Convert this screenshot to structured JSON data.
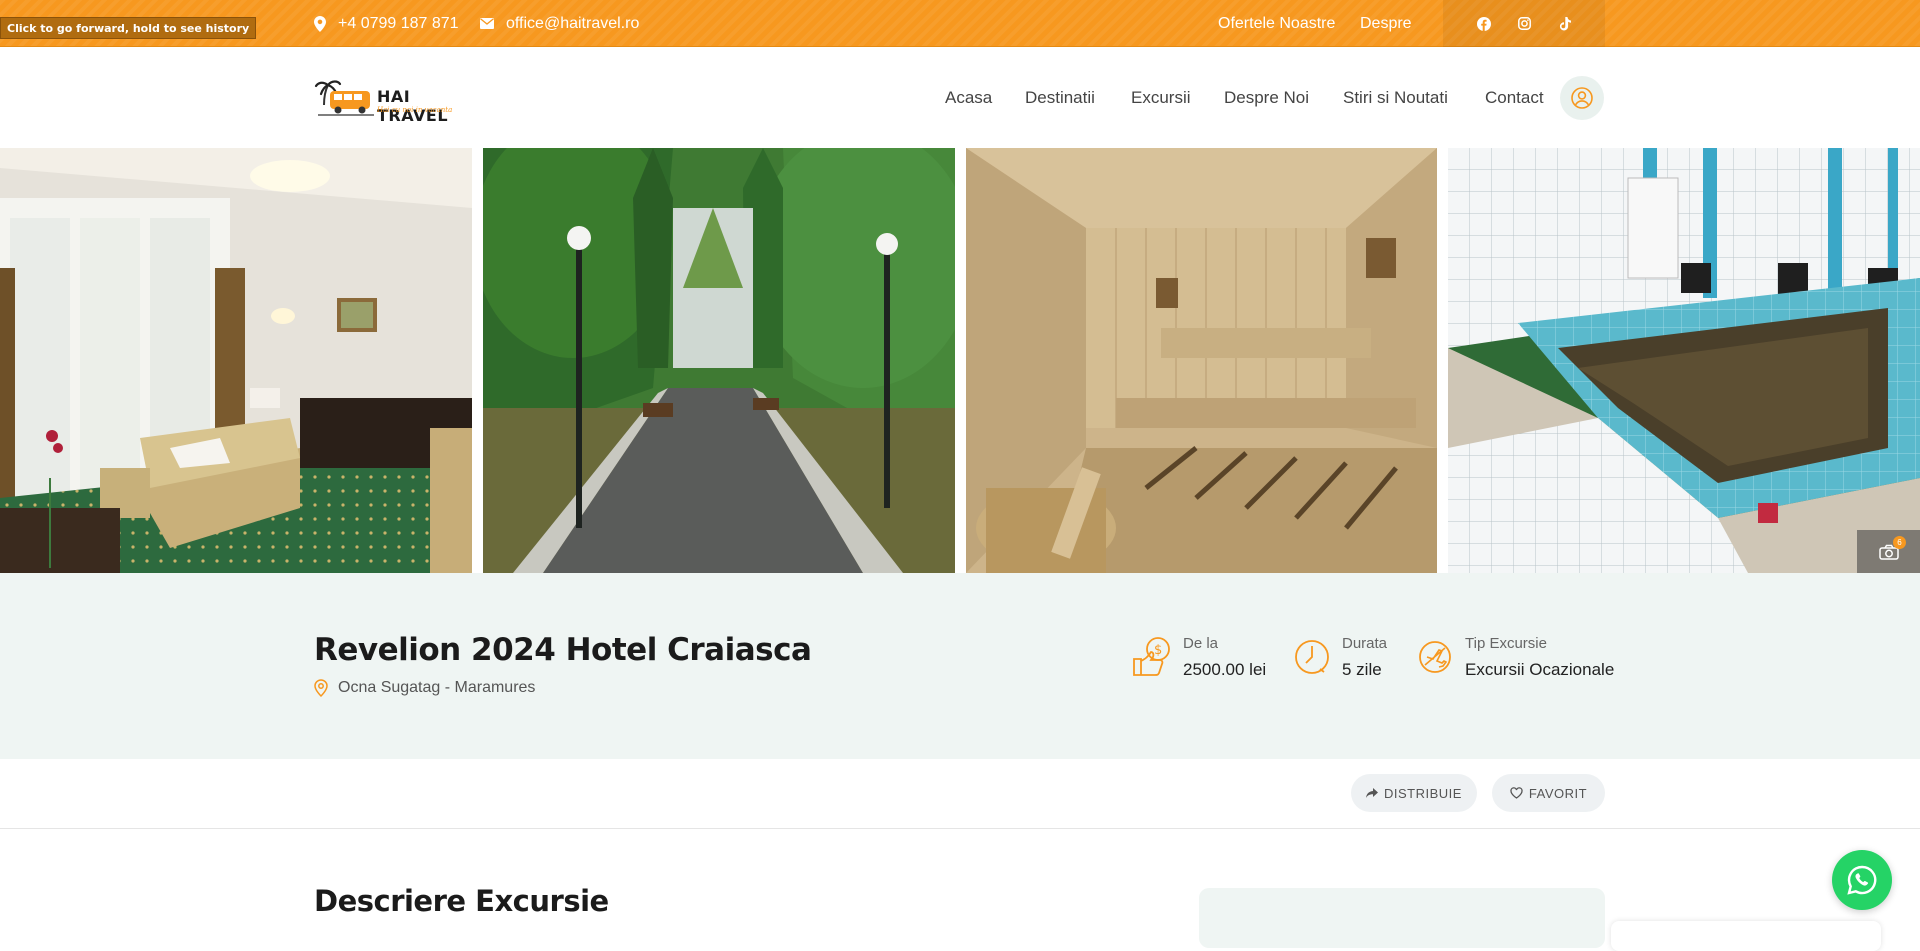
{
  "browser": {
    "back_tooltip": "Click to go forward, hold to see history"
  },
  "topbar": {
    "phone": "+4 0799 187 871",
    "email": "office@haitravel.ro",
    "links": [
      "Ofertele Noastre",
      "Despre"
    ],
    "social": [
      "facebook-icon",
      "instagram-icon",
      "tiktok-icon"
    ],
    "color": "#f7981f"
  },
  "header": {
    "logo_text": "HAI TRAVEL",
    "logo_tagline": "Hai cu noi in vacanta",
    "nav": [
      "Acasa",
      "Destinatii",
      "Excursii",
      "Despre Noi",
      "Stiri si Noutati",
      "Contact"
    ],
    "account_icon": "user-circle-icon"
  },
  "gallery": {
    "photos": [
      "hotel-room-photo",
      "park-alley-photo",
      "sauna-photo",
      "indoor-pool-photo"
    ],
    "count": "6"
  },
  "tour": {
    "title": "Revelion 2024 Hotel Craiasca",
    "location": "Ocna Sugatag - Maramures",
    "price_label": "De la",
    "price_value": "2500.00 lei",
    "duration_label": "Durata",
    "duration_value": "5 zile",
    "type_label": "Tip Excursie",
    "type_value": "Excursii Ocazionale"
  },
  "actions": {
    "share": "DISTRIBUIE",
    "favorite": "FAVORIT"
  },
  "description": {
    "title": "Descriere Excursie"
  },
  "colors": {
    "accent": "#f7981f",
    "band": "#eff5f3",
    "whatsapp": "#25d366"
  }
}
